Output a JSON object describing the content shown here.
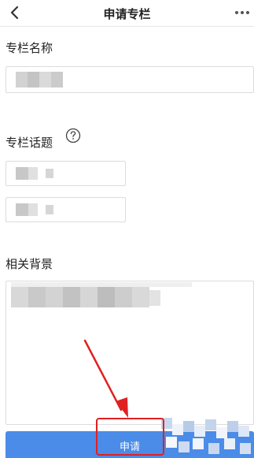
{
  "navbar": {
    "title": "申请专栏",
    "back_icon": "chevron-left-icon",
    "more_icon": "more-dots-icon"
  },
  "form": {
    "name_label": "专栏名称",
    "topic_label": "专栏话题",
    "topic_help_icon": "question-circle-icon",
    "background_label": "相关背景"
  },
  "submit": {
    "label": "申请"
  },
  "colors": {
    "primary_button": "#4a8ce8",
    "annotation": "#e02020",
    "border": "#dcdcdc"
  }
}
